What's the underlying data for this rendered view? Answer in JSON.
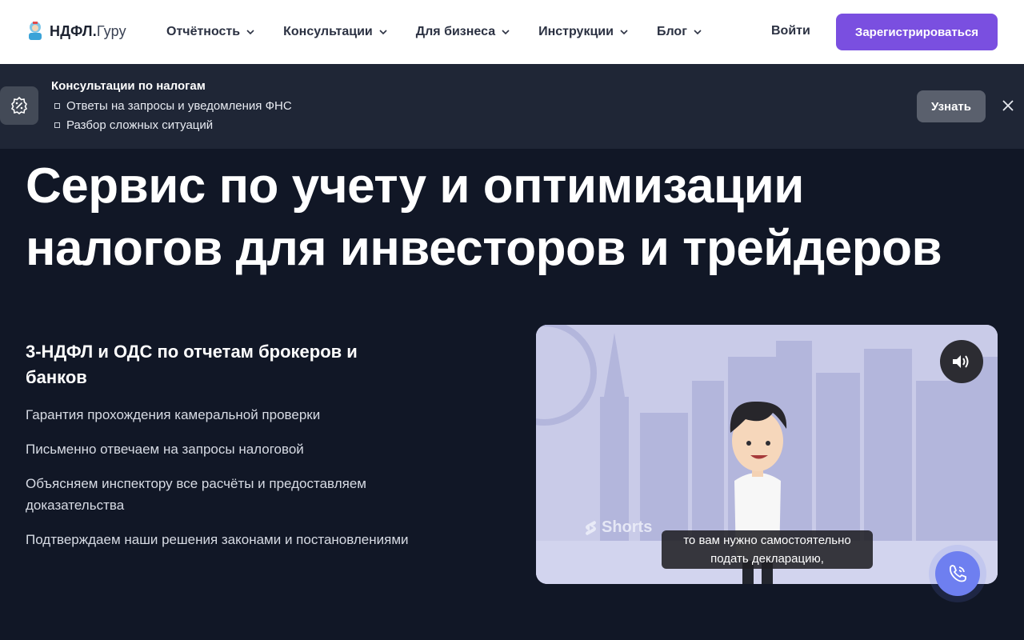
{
  "header": {
    "logo_bold": "НДФЛ.",
    "logo_light": "Гуру",
    "logo_icon": "mascot-logo-icon",
    "nav": [
      {
        "label": "Отчётность"
      },
      {
        "label": "Консультации"
      },
      {
        "label": "Для бизнеса"
      },
      {
        "label": "Инструкции"
      },
      {
        "label": "Блог"
      }
    ],
    "login_label": "Войти",
    "register_label": "Зарегистрироваться",
    "accent_color": "#7a4fe0"
  },
  "banner": {
    "title": "Консультации по налогам",
    "items": [
      "Ответы на запросы и уведомления ФНС",
      "Разбор сложных ситуаций"
    ],
    "button_label": "Узнать",
    "icon": "percent-badge-icon",
    "close_icon": "close-icon"
  },
  "hero": {
    "title_line1": "Сервис по учету и оптимизации",
    "title_line2": "налогов для инвесторов и трейдеров"
  },
  "features": {
    "heading": "3-НДФЛ и ОДС по отчетам брокеров и банков",
    "items": [
      "Гарантия прохождения камеральной проверки",
      "Письменно отвечаем на запросы налоговой",
      "Объясняем инспектору все расчёты и предоставляем доказательства",
      "Подтверждаем наши решения законами и постановлениями"
    ]
  },
  "video": {
    "watermark": "Shorts",
    "caption_line1": "то вам нужно самостоятельно",
    "caption_line2": "подать декларацию,",
    "sound_icon": "speaker-icon",
    "call_icon": "phone-icon"
  }
}
